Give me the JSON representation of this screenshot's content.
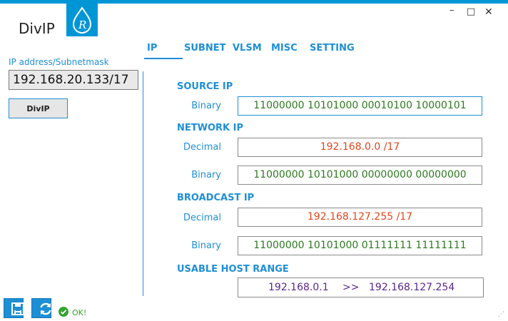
{
  "window": {
    "title": "DivIP",
    "controls": {
      "minimize": "–",
      "maximize": "□",
      "close": "✕"
    }
  },
  "sidebar": {
    "input_label": "IP address/Subnetmask",
    "input_value": "192.168.20.133/17",
    "button_label": "DivIP"
  },
  "tabs": [
    {
      "label": "IP",
      "active": true
    },
    {
      "label": "SUBNET",
      "active": false
    },
    {
      "label": "VLSM",
      "active": false
    },
    {
      "label": "MISC",
      "active": false
    },
    {
      "label": "SETTING",
      "active": false
    }
  ],
  "source_ip": {
    "heading": "SOURCE IP",
    "binary_label": "Binary",
    "binary": "11000000 10101000 00010100 10000101"
  },
  "network_ip": {
    "heading": "NETWORK IP",
    "decimal_label": "Decimal",
    "decimal": "192.168.0.0 /17",
    "binary_label": "Binary",
    "binary": "11000000 10101000 00000000 00000000"
  },
  "broadcast_ip": {
    "heading": "BROADCAST IP",
    "decimal_label": "Decimal",
    "decimal": "192.168.127.255 /17",
    "binary_label": "Binary",
    "binary": "11000000 10101000 01111111 11111111"
  },
  "host_range": {
    "heading": "USABLE HOST RANGE",
    "start": "192.168.0.1",
    "separator": ">>",
    "end": "192.168.127.254"
  },
  "statusbar": {
    "status_text": "OK!",
    "save_icon": "save-icon",
    "refresh_icon": "refresh-icon",
    "status_icon": "check-circle-icon"
  },
  "colors": {
    "accent": "#1e8fd5",
    "binary_text": "#2d7a1f",
    "decimal_text": "#e0461c",
    "range_text": "#5b2490",
    "ok_text": "#33a532"
  }
}
